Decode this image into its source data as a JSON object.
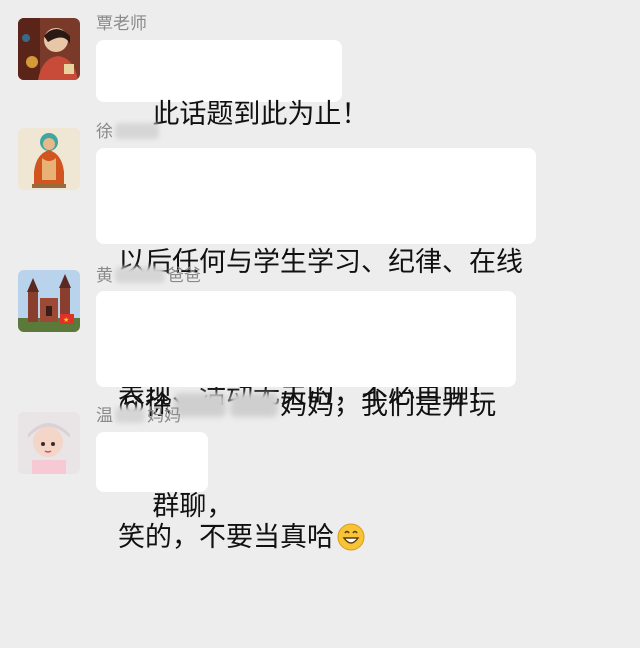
{
  "messages": [
    {
      "sender": "覃老师",
      "text": "此话题到此为止！",
      "avatar_icon": "avatar-illustration-icon"
    },
    {
      "sender_visible": "徐",
      "line1": "以后任何与学生学习、纪律、在线",
      "line2": "表现、活动无关的，不必再聊！",
      "avatar_icon": "buddha-icon"
    },
    {
      "sender_prefix": "黄",
      "sender_suffix": "爸爸",
      "line1_prefix": "@徐",
      "line1_suffix": "妈妈，我们是开玩",
      "line2": "笑的，不要当真哈",
      "emoji_icon": "grinning-face-icon",
      "avatar_icon": "castle-icon"
    },
    {
      "sender_prefix": "温",
      "sender_suffix": "妈妈",
      "text": "群聊，",
      "avatar_icon": "child-photo-icon"
    }
  ],
  "colors": {
    "background": "#ededed",
    "bubble": "#ffffff",
    "sender_name": "#8a8a8a",
    "text": "#111111"
  }
}
